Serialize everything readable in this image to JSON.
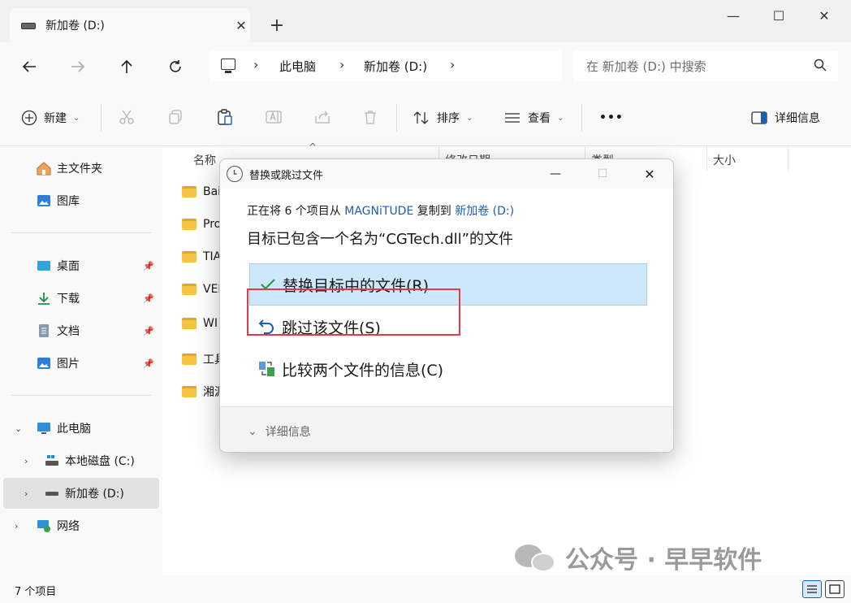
{
  "window": {
    "tab_title": "新加卷 (D:)",
    "new_tab": "+",
    "minimize": "—",
    "maximize": "☐",
    "close": "✕"
  },
  "nav": {
    "crumbs": [
      "此电脑",
      "新加卷 (D:)"
    ],
    "search_placeholder": "在 新加卷 (D:) 中搜索"
  },
  "toolbar": {
    "new_label": "新建",
    "sort_label": "排序",
    "view_label": "查看",
    "more": "•••",
    "details_label": "详细信息"
  },
  "sidebar": {
    "quick": [
      {
        "label": "主文件夹",
        "icon": "home-icon"
      },
      {
        "label": "图库",
        "icon": "gallery-icon"
      }
    ],
    "pinned": [
      {
        "label": "桌面",
        "icon": "desktop-icon"
      },
      {
        "label": "下载",
        "icon": "download-icon"
      },
      {
        "label": "文档",
        "icon": "documents-icon"
      },
      {
        "label": "图片",
        "icon": "pictures-icon"
      }
    ],
    "pc": {
      "label": "此电脑"
    },
    "drives": [
      {
        "label": "本地磁盘 (C:)"
      },
      {
        "label": "新加卷 (D:)"
      }
    ],
    "network": {
      "label": "网络"
    }
  },
  "files": {
    "columns": [
      "名称",
      "修改日期",
      "类型",
      "大小"
    ],
    "items": [
      "Bai",
      "Pro",
      "TIA",
      "VEI",
      "WI",
      "工具",
      "湘源"
    ]
  },
  "status": {
    "count": "7 个项目"
  },
  "dialog": {
    "title": "替换或跳过文件",
    "line1_prefix": "正在将 6 个项目从 ",
    "line1_source": "MAGNiTUDE",
    "line1_mid": " 复制到 ",
    "line1_dest": "新加卷 (D:)",
    "line2": "目标已包含一个名为“CGTech.dll”的文件",
    "option_replace": "替换目标中的文件(R)",
    "option_skip": "跳过该文件(S)",
    "option_compare": "比较两个文件的信息(C)",
    "details": "详细信息"
  },
  "watermark": {
    "text": "公众号 · 早早软件"
  },
  "colors": {
    "accent": "#1a5fb4",
    "highlight": "#cde8fb",
    "red_outline": "#e23b45",
    "folder": "#f5c443"
  }
}
